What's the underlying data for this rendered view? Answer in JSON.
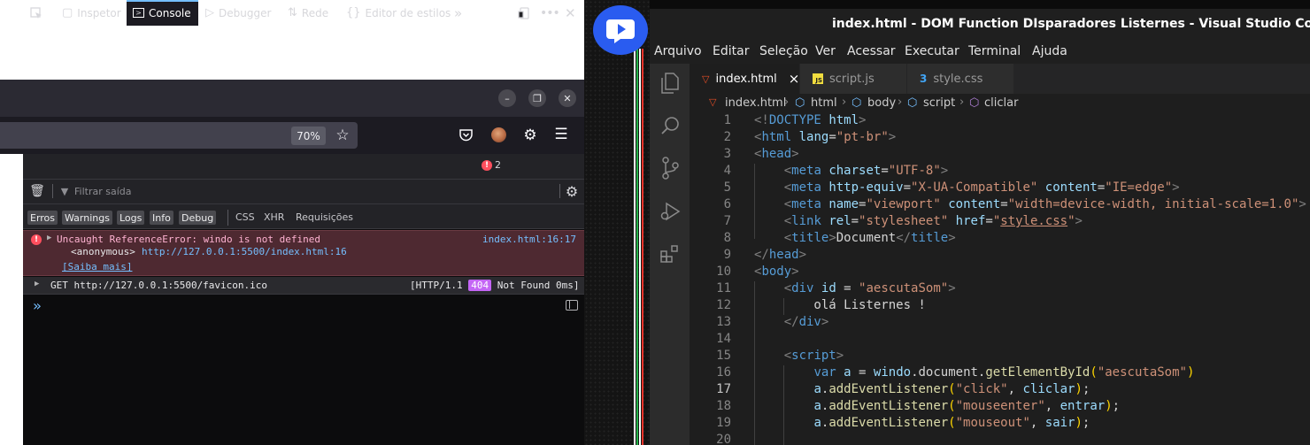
{
  "browser": {
    "zoom": "70%",
    "devtools": {
      "tabs": [
        "Inspetor",
        "Console",
        "Debugger",
        "Rede",
        "Editor de estilos"
      ],
      "error_count": "2",
      "filter_placeholder": "Filtrar saída",
      "filter_chips": [
        "Erros",
        "Warnings",
        "Logs",
        "Info",
        "Debug"
      ],
      "filter_extra": [
        "CSS",
        "XHR",
        "Requisições"
      ],
      "error_message": {
        "text": "Uncaught ReferenceError: windo is not defined",
        "location": "index.html:16:17",
        "stack_fn": "<anonymous>",
        "stack_url": "http://127.0.0.1:5500/index.html:16",
        "learn_more": "[Saiba mais]"
      },
      "network_message": {
        "text": "GET http://127.0.0.1:5500/favicon.ico",
        "status_prefix": "[HTTP/1.1",
        "status_code": "404",
        "status_suffix": "Not Found 0ms]"
      },
      "prompt": "»"
    }
  },
  "vscode": {
    "title": "index.html - DOM Function DIsparadores Listernes - Visual Studio Code",
    "menu": [
      "Arquivo",
      "Editar",
      "Seleção",
      "Ver",
      "Acessar",
      "Executar",
      "Terminal",
      "Ajuda"
    ],
    "tabs": [
      {
        "label": "index.html",
        "close": "×"
      },
      {
        "label": "script.js"
      },
      {
        "label": "style.css"
      }
    ],
    "breadcrumbs": [
      "index.html",
      "html",
      "body",
      "script",
      "cliclar"
    ],
    "line_numbers": [
      "1",
      "2",
      "3",
      "4",
      "5",
      "6",
      "7",
      "8",
      "9",
      "10",
      "11",
      "12",
      "13",
      "14",
      "15",
      "16",
      "17",
      "18",
      "19",
      "20"
    ],
    "code_lines": [
      "<!DOCTYPE html>",
      "<html lang=\"pt-br\">",
      "<head>",
      "    <meta charset=\"UTF-8\">",
      "    <meta http-equiv=\"X-UA-Compatible\" content=\"IE=edge\">",
      "    <meta name=\"viewport\" content=\"width=device-width, initial-scale=1.0\">",
      "    <link rel=\"stylesheet\" href=\"style.css\">",
      "    <title>Document</title>",
      "</head>",
      "<body>",
      "    <div id = \"aescutaSom\">",
      "        olá Listernes !",
      "    </div>",
      "",
      "    <script>",
      "        var a = windo.document.getElementById(\"aescutaSom\")",
      "        a.addEventListener(\"click\", cliclar);",
      "        a.addEventListener(\"mouseenter\", entrar);",
      "        a.addEventListener(\"mouseout\", sair);",
      ""
    ]
  },
  "colors": {
    "vscode_bg": "#1e1e1e",
    "devtools_bg": "#0c0c0d",
    "error_row_bg": "#4e2931",
    "accent_blue": "#75bfff",
    "badge_404": "#c465f5",
    "logo_blue": "#2a5cf0"
  }
}
